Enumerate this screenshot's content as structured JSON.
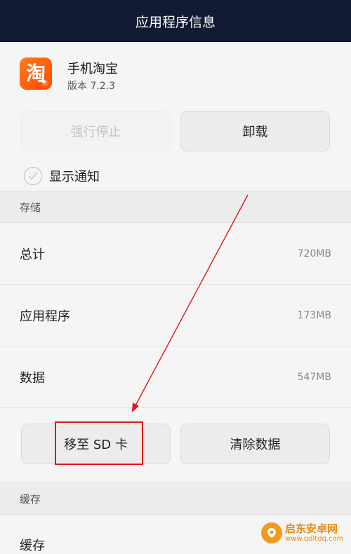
{
  "titlebar": {
    "title": "应用程序信息"
  },
  "app": {
    "name": "手机淘宝",
    "version": "版本 7.2.3",
    "icon_glyph": "淘",
    "icon_color": "#ff5a00"
  },
  "actions": {
    "force_stop": "强行停止",
    "uninstall": "卸载"
  },
  "notification": {
    "label": "显示通知",
    "checked": false
  },
  "storage": {
    "header": "存储",
    "rows": [
      {
        "label": "总计",
        "value": "720MB"
      },
      {
        "label": "应用程序",
        "value": "173MB"
      },
      {
        "label": "数据",
        "value": "547MB"
      }
    ],
    "move_to_sd": "移至 SD 卡",
    "clear_data": "清除数据"
  },
  "cache": {
    "header": "缓存",
    "row_label": "缓存"
  },
  "annotation": {
    "color": "#e0161b"
  },
  "watermark": {
    "title": "启东安卓网",
    "url": "www.qdltdq.com"
  }
}
